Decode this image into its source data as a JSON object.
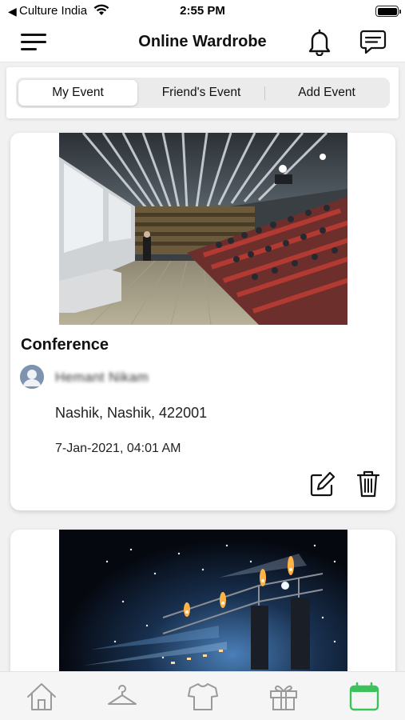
{
  "status_bar": {
    "back_glyph": "◀",
    "carrier": "Culture India",
    "time": "2:55 PM",
    "icons": [
      "wifi-icon",
      "battery-icon"
    ]
  },
  "header": {
    "title": "Online Wardrobe",
    "icons": [
      "menu-icon",
      "bell-icon",
      "chat-icon"
    ]
  },
  "tabs": [
    {
      "label": "My Event",
      "active": true
    },
    {
      "label": "Friend's Event",
      "active": false
    },
    {
      "label": "Add Event",
      "active": false
    }
  ],
  "events": [
    {
      "title": "Conference",
      "owner_name": "Hemant Nikam",
      "location": "Nashik, Nashik, 422001",
      "datetime": "7-Jan-2021, 04:01 AM",
      "image": "conference-hall-photo",
      "actions": [
        "edit-icon",
        "trash-icon"
      ]
    },
    {
      "image": "concert-stage-photo"
    }
  ],
  "bottom_nav": [
    {
      "icon": "home-icon",
      "active": false
    },
    {
      "icon": "hanger-icon",
      "active": false
    },
    {
      "icon": "shirt-icon",
      "active": false
    },
    {
      "icon": "gift-icon",
      "active": false
    },
    {
      "icon": "calendar-icon",
      "active": true
    }
  ],
  "colors": {
    "accent": "#3cc25a",
    "icon_inactive": "#9a9a9a",
    "background": "#f1f1f1"
  }
}
